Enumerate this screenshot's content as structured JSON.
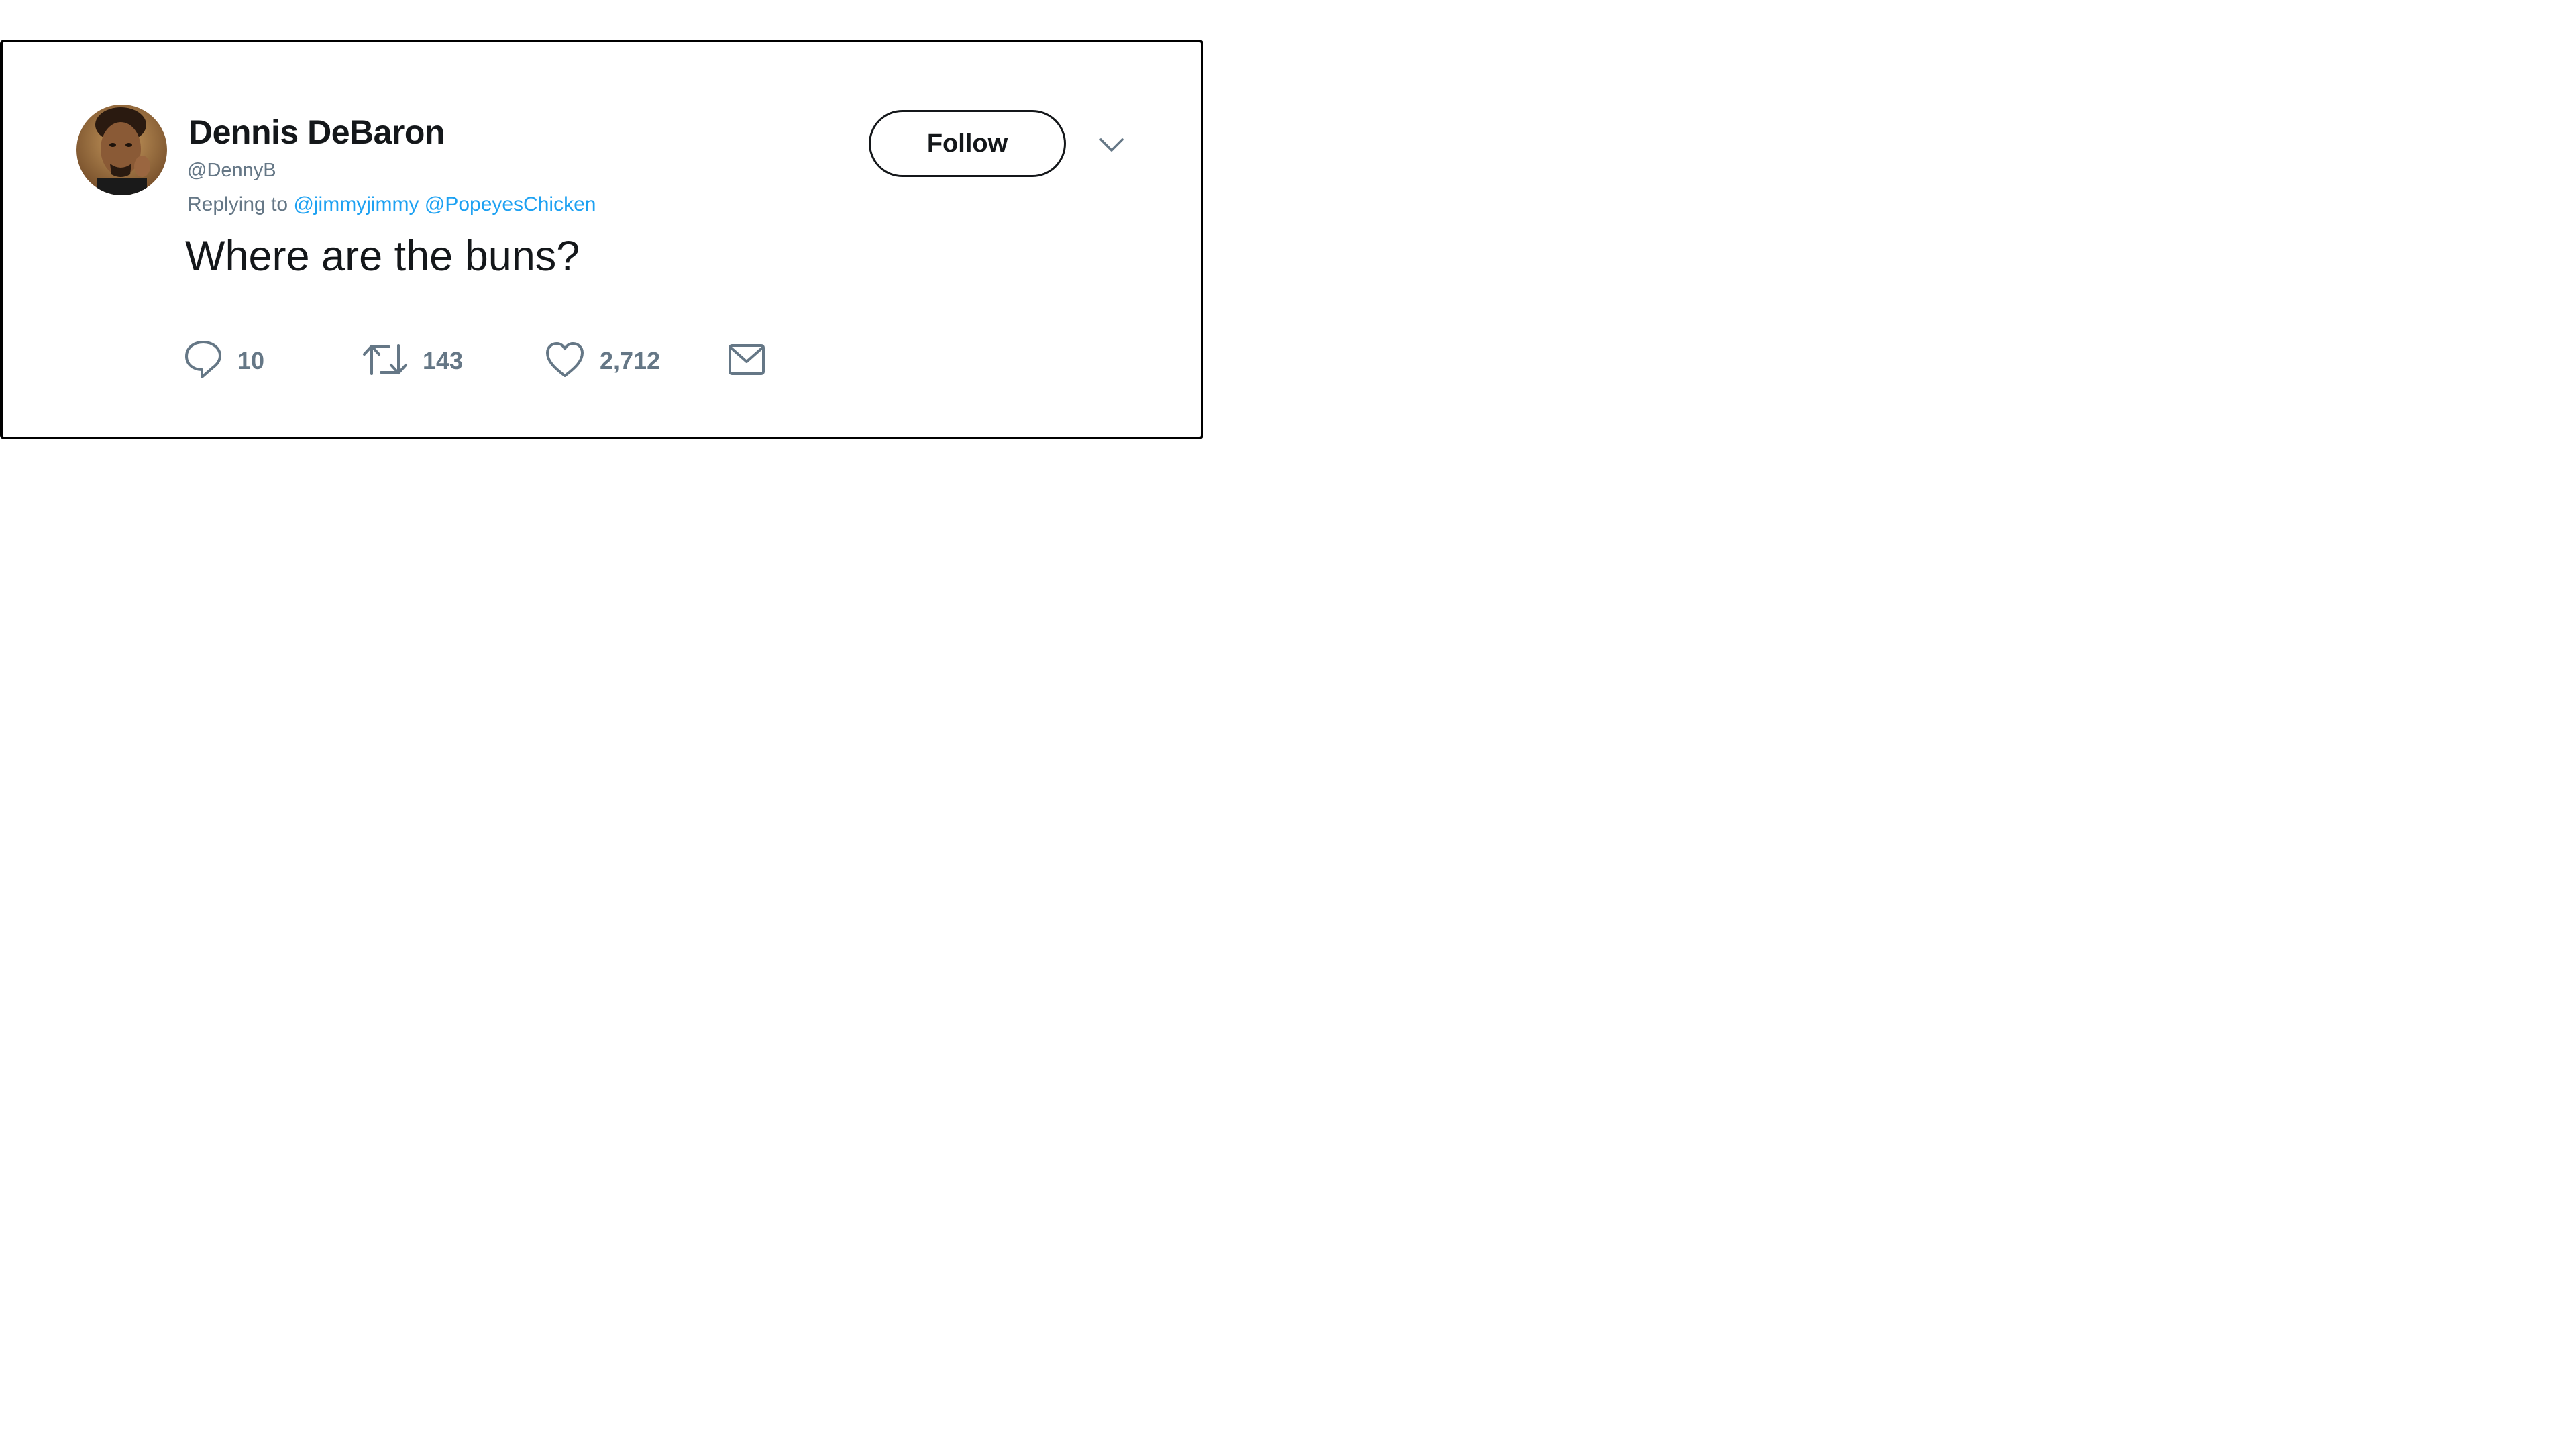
{
  "tweet": {
    "author": {
      "display_name": "Dennis DeBaron",
      "handle": "@DennyB"
    },
    "reply_context": {
      "prefix": "Replying to",
      "mentions": [
        "@jimmyjimmy",
        "@PopeyesChicken"
      ]
    },
    "text": "Where are the buns?",
    "follow_label": "Follow",
    "actions": {
      "replies": "10",
      "retweets": "143",
      "likes": "2,712"
    },
    "icons": [
      "avatar",
      "chevron-down-icon",
      "reply-icon",
      "retweet-icon",
      "like-icon",
      "message-icon"
    ],
    "colors": {
      "text": "#14171a",
      "muted": "#657786",
      "link": "#1da1f2",
      "border": "#000000"
    }
  }
}
